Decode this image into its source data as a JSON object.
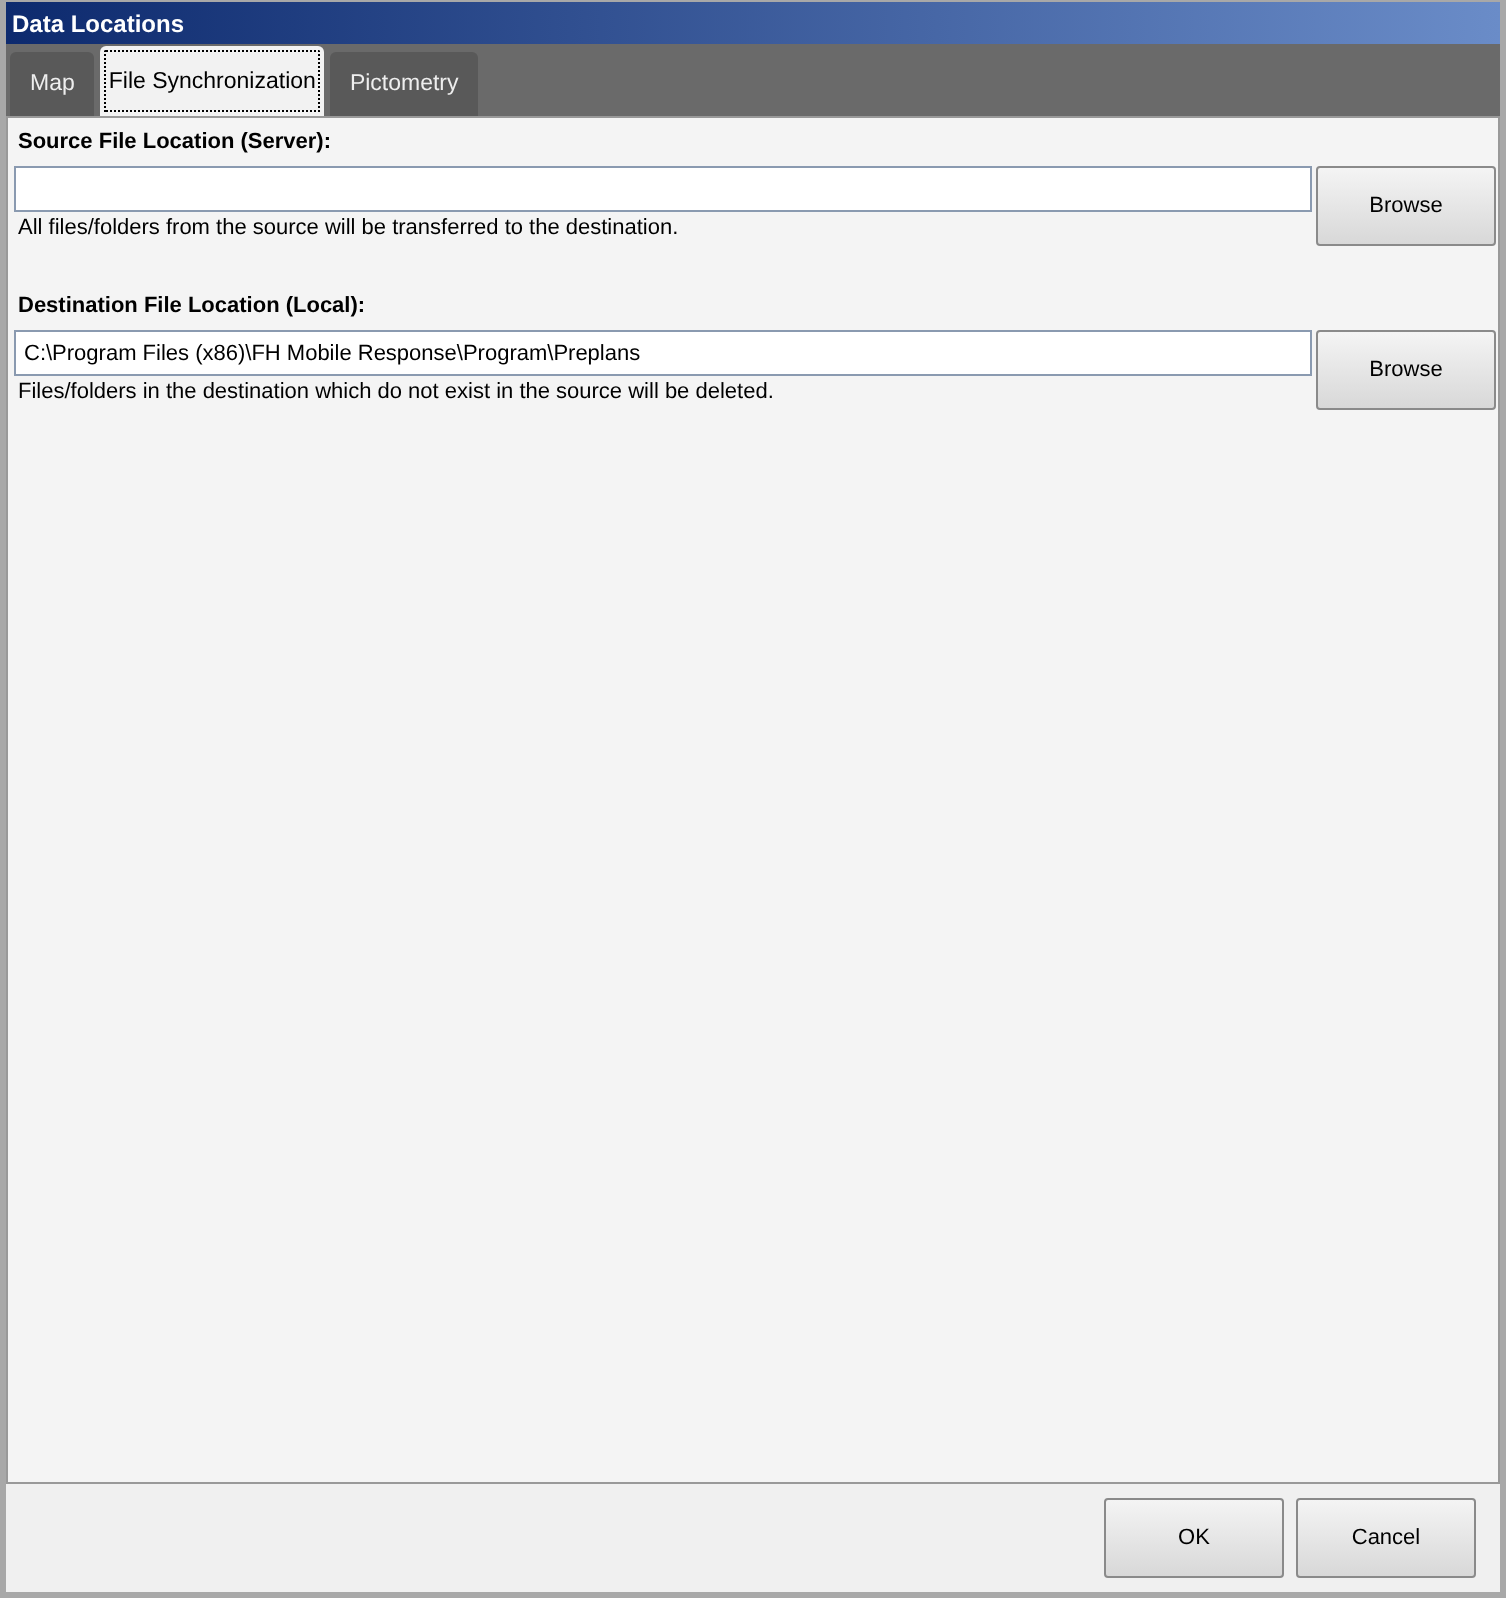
{
  "window": {
    "title": "Data Locations"
  },
  "tabs": [
    {
      "label": "Map",
      "selected": false
    },
    {
      "label": "File Synchronization",
      "selected": true
    },
    {
      "label": "Pictometry",
      "selected": false
    }
  ],
  "sections": [
    {
      "label": "Source File Location (Server):",
      "button": "Browse",
      "hint": "All files/folders from the source will be transferred to the destination."
    },
    {
      "label": "Destination File Location (Local):",
      "value": "C:\\Program Files (x86)\\FH Mobile Response\\Program\\Preplans",
      "button": "Browse",
      "hint": "Files/folders in the destination which do not exist in the source will be deleted."
    }
  ],
  "buttons": [
    "OK",
    "Cancel"
  ]
}
